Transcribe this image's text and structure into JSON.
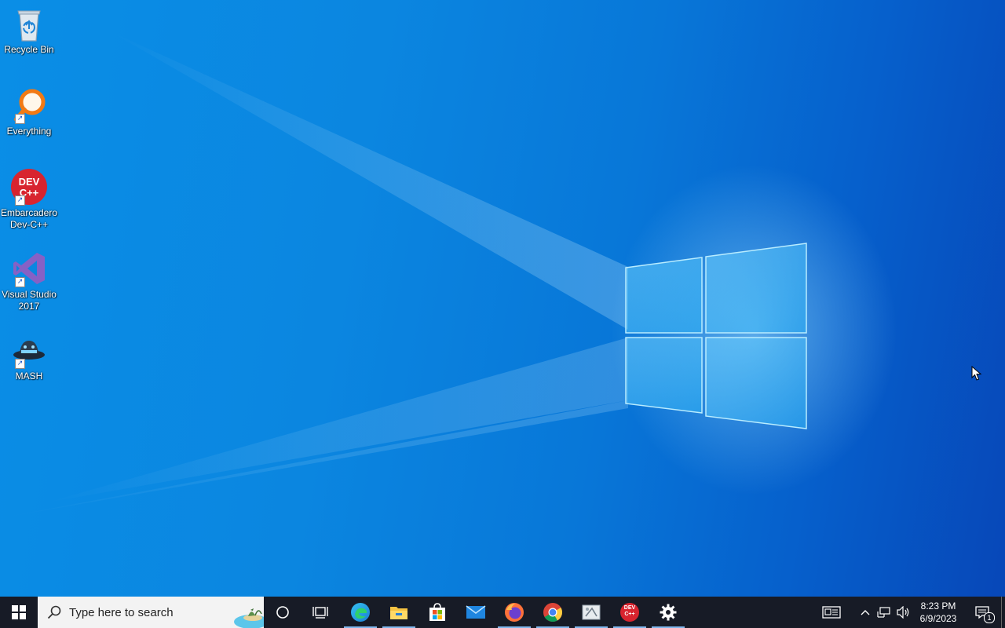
{
  "desktop_icons": [
    {
      "label": "Recycle Bin",
      "icon": "recycle-bin-icon"
    },
    {
      "label": "Everything",
      "icon": "everything-search-icon"
    },
    {
      "label": "Embarcadero Dev-C++",
      "icon": "devcpp-icon"
    },
    {
      "label": "Visual Studio 2017",
      "icon": "visual-studio-icon"
    },
    {
      "label": "MASH",
      "icon": "mash-icon"
    }
  ],
  "taskbar": {
    "search_placeholder": "Type here to search",
    "pinned_apps": [
      {
        "name": "Microsoft Edge",
        "icon": "edge-icon",
        "running": true
      },
      {
        "name": "File Explorer",
        "icon": "file-explorer-icon",
        "running": true
      },
      {
        "name": "Microsoft Store",
        "icon": "store-icon",
        "running": false
      },
      {
        "name": "Mail",
        "icon": "mail-icon",
        "running": false
      },
      {
        "name": "Firefox",
        "icon": "firefox-icon",
        "running": true
      },
      {
        "name": "Google Chrome",
        "icon": "chrome-icon",
        "running": true
      },
      {
        "name": "Snipping Tool",
        "icon": "snipping-tool-icon",
        "running": true
      },
      {
        "name": "Dev-C++",
        "icon": "devcpp-icon",
        "running": true
      },
      {
        "name": "Settings",
        "icon": "gear-icon",
        "running": true
      }
    ],
    "devcpp_badge_text": "DEV C++",
    "clock_time": "8:23 PM",
    "clock_date": "6/9/2023",
    "notification_count": "1"
  },
  "colors": {
    "desktop_bg": "#0a8ee6",
    "taskbar_bg": "#171b26",
    "running_indicator": "#7fb7ec"
  }
}
